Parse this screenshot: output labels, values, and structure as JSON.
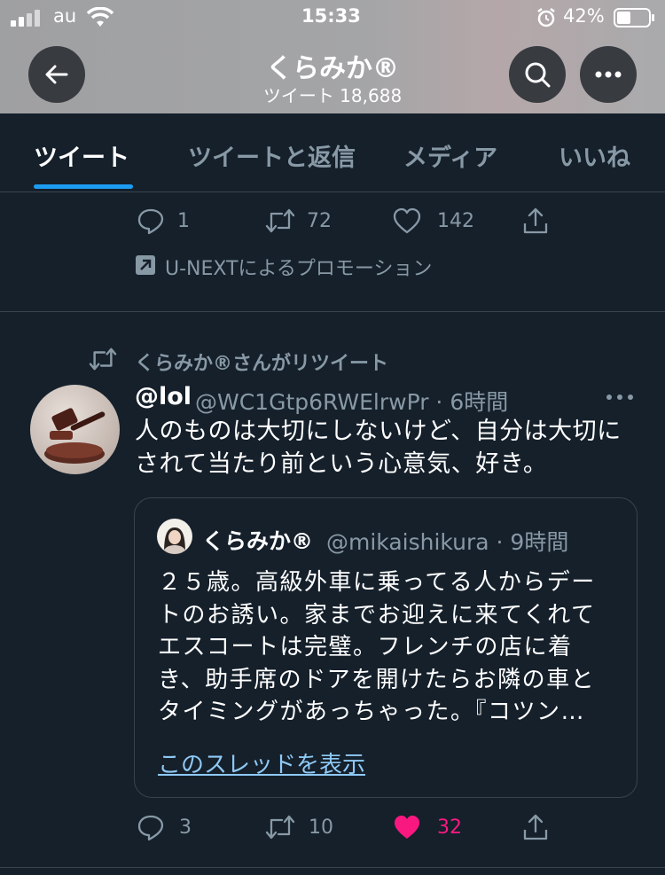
{
  "status_bar": {
    "carrier": "au",
    "time": "15:33",
    "battery": "42%"
  },
  "header": {
    "name": "くらみか®",
    "tweet_count": "ツイート 18,688"
  },
  "tabs": [
    {
      "label": "ツイート",
      "active": true
    },
    {
      "label": "ツイートと返信",
      "active": false
    },
    {
      "label": "メディア",
      "active": false
    },
    {
      "label": "いいね",
      "active": false
    }
  ],
  "promo": {
    "replies": "1",
    "retweets": "72",
    "likes": "142",
    "label": "U-NEXTによるプロモーション"
  },
  "tweet": {
    "retweet_context": "くらみか®さんがリツイート",
    "display_name": "@lol",
    "handle_time": "@WC1Gtp6RWElrwPr · 6時間",
    "text_lines": [
      "人のものは大切にしないけど、自分は大切に",
      "されて当たり前という心意気、好き。"
    ],
    "quote": {
      "name": "くらみか®",
      "handle_time": "@mikaishikura · 9時間",
      "text_lines": [
        "２５歳。高級外車に乗ってる人からデー",
        "トのお誘い。家までお迎えに来てくれて",
        "エスコートは完璧。フレンチの店に着",
        "き、助手席のドアを開けたらお隣の車と",
        "タイミングがあっちゃった。『コツン…"
      ],
      "show_thread": "このスレッドを表示"
    },
    "replies": "3",
    "retweets": "10",
    "likes": "32"
  },
  "colors": {
    "background": "#15202b",
    "accent": "#1d9bf0",
    "like": "#f91880",
    "muted": "#8899a6"
  }
}
